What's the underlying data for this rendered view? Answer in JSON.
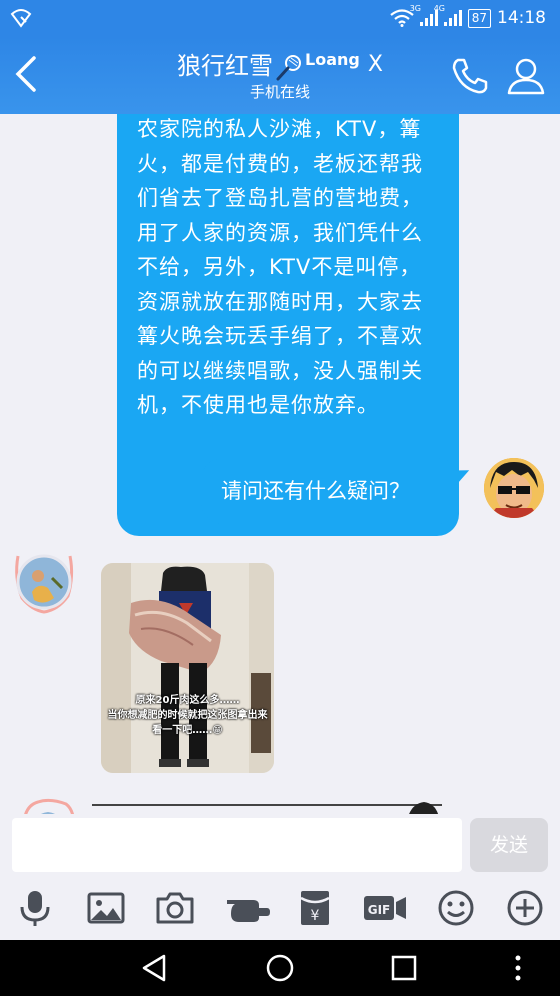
{
  "status_bar": {
    "network_3g": "3G",
    "network_4g": "4G",
    "battery": "87",
    "time": "14:18"
  },
  "header": {
    "title": "狼行红雪",
    "badge_text": "Loang",
    "badge_x": "X",
    "subtitle": "手机在线"
  },
  "messages": {
    "long_text": "农家院的私人沙滩，KTV，篝火，都是付费的，老板还帮我们省去了登岛扎营的营地费，用了人家的资源，我们凭什么不给，另外，KTV不是叫停，资源就放在那随时用，大家去篝火晚会玩丢手绢了，不喜欢的可以继续唱歌，没人强制关机，不使用也是你放弃。",
    "question": "请问还有什么疑问？",
    "photo_caption_line1": "原来20斤肉这么多……",
    "photo_caption_line2": "当你想减肥的时候就把这张图拿出来",
    "photo_caption_line3": "看一下吧……😁"
  },
  "composer": {
    "input_value": "",
    "send_label": "发送"
  },
  "toolbar": [
    "mic-icon",
    "image-icon",
    "camera-icon",
    "poke-icon",
    "red-packet-icon",
    "gif-icon",
    "emoji-icon",
    "plus-icon"
  ],
  "colors": {
    "header_bg": "#2e86e6",
    "bubble": "#1aa7f3",
    "background": "#f0f0f6"
  }
}
